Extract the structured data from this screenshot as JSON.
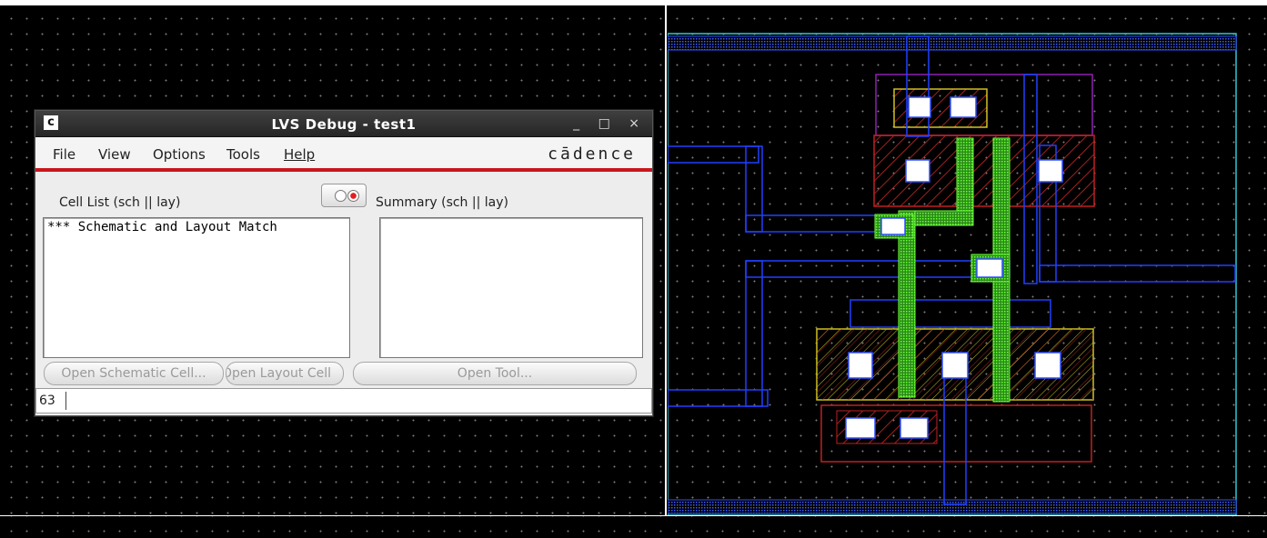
{
  "window": {
    "app_icon": "c",
    "title": "LVS Debug - test1",
    "controls": [
      "_",
      "□",
      "×"
    ]
  },
  "menu": {
    "items": [
      "File",
      "View",
      "Options",
      "Tools",
      "Help"
    ],
    "brand": "cādence"
  },
  "cell_list": {
    "label": "Cell List (sch || lay)",
    "items": [
      "*** Schematic and Layout Match"
    ]
  },
  "summary": {
    "label": "Summary (sch || lay)",
    "items": []
  },
  "buttons": {
    "open_schematic": "Open Schematic Cell...",
    "open_layout": "Open Layout Cell",
    "open_tool": "Open Tool..."
  },
  "status": {
    "value": "63"
  },
  "icons": [
    "app-icon",
    "minimize-icon",
    "maximize-icon",
    "close-icon",
    "toggle-indicator-icon"
  ]
}
